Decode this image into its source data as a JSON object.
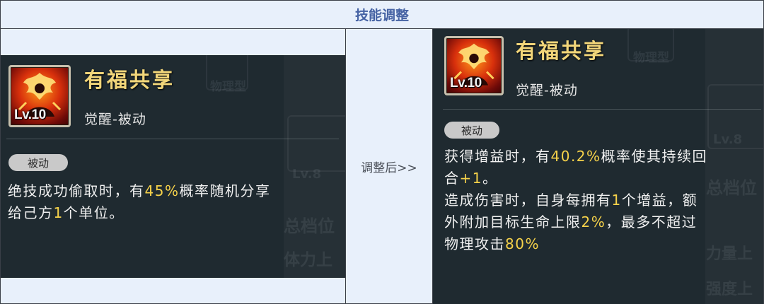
{
  "header": {
    "title": "技能调整"
  },
  "middle": {
    "label": "调整后>>"
  },
  "before": {
    "skill_name": "有福共享",
    "skill_type": "觉醒-被动",
    "level": "Lv.10",
    "badge": "被动",
    "desc_line1_a": "绝技成功偷取时，有",
    "desc_line1_hl": "45%",
    "desc_line1_b": "概率随机分享",
    "desc_line2_a": "给己方",
    "desc_line2_hl": "1",
    "desc_line2_b": "个单位。",
    "bg_texts": [
      "物理型",
      "总档位",
      "体力上",
      "Lv.8"
    ]
  },
  "after": {
    "skill_name": "有福共享",
    "skill_type": "觉醒-被动",
    "level": "Lv.10",
    "badge": "被动",
    "l1_a": "获得增益时，有",
    "l1_hl": "40.2%",
    "l1_b": "概率使其持续回",
    "l2_a": "合",
    "l2_hl": "+1",
    "l2_b": "。",
    "l3_a": "造成伤害时，自身每拥有",
    "l3_hl": "1",
    "l3_b": "个增益，额",
    "l4_a": "外附加目标生命上限",
    "l4_hl": "2%",
    "l4_b": "，最多不超过",
    "l5_a": "物理攻击",
    "l5_hl": "80%",
    "bg_texts": [
      "物理型",
      "总档位",
      "力量上",
      "强度上",
      "Lv.8"
    ]
  },
  "colors": {
    "accent": "#4663a4",
    "highlight": "#f6d24a",
    "panel": "#1f2a30",
    "name": "#f2d67a"
  }
}
